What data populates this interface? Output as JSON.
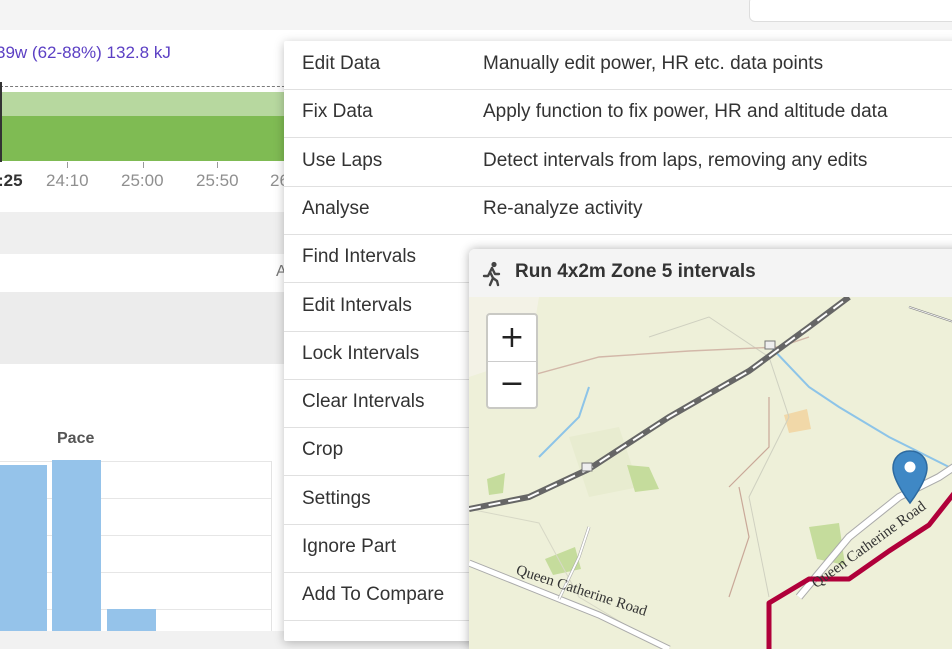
{
  "summary": {
    "power_text": "39w (62-88%) 132.8 kJ"
  },
  "time_axis": {
    "cursor_label": ":25",
    "ticks": [
      "24:10",
      "25:00",
      "25:50",
      "26"
    ]
  },
  "truncated_column_letter": "A",
  "pace_chart": {
    "title": "Pace",
    "chart_data": {
      "type": "bar",
      "title": "Pace",
      "bars_visible": 3,
      "relative_heights": [
        0.97,
        1.0,
        0.13
      ]
    }
  },
  "context_menu": {
    "items": [
      {
        "label": "Edit Data",
        "desc": "Manually edit power, HR etc. data points"
      },
      {
        "label": "Fix Data",
        "desc": "Apply function to fix power, HR and altitude data"
      },
      {
        "label": "Use Laps",
        "desc": "Detect intervals from laps, removing any edits"
      },
      {
        "label": "Analyse",
        "desc": "Re-analyze activity"
      },
      {
        "label": "Find Intervals",
        "desc": ""
      },
      {
        "label": "Edit Intervals",
        "desc": ""
      },
      {
        "label": "Lock Intervals",
        "desc": ""
      },
      {
        "label": "Clear Intervals",
        "desc": ""
      },
      {
        "label": "Crop",
        "desc": ""
      },
      {
        "label": "Settings",
        "desc": ""
      },
      {
        "label": "Ignore Part",
        "desc": ""
      },
      {
        "label": "Add To Compare",
        "desc": ""
      }
    ]
  },
  "popup": {
    "title": "Run 4x2m Zone 5 intervals",
    "icon": "runner-icon",
    "map": {
      "zoom_in": "+",
      "zoom_out": "−",
      "road_labels": [
        "Queen Catherine Road",
        "Queen Catherine Road"
      ],
      "route_color": "#b0003a",
      "marker_color": "#3f88c5"
    }
  },
  "colors": {
    "accent": "#5b3fc4",
    "chart_green": "#7fbb53",
    "bar_blue": "#95c3ea"
  }
}
